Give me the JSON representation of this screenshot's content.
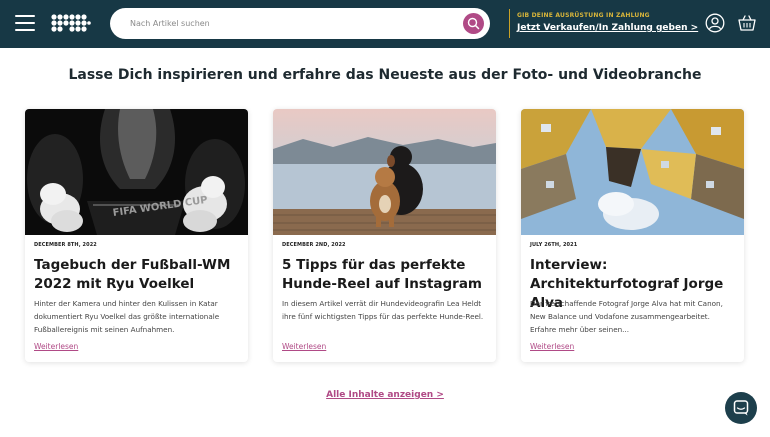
{
  "header": {
    "search_placeholder": "Nach Artikel suchen",
    "promo_top": "GIB DEINE AUSRÜSTUNG IN ZAHLUNG",
    "promo_link": "Jetzt Verkaufen/In Zahlung geben >",
    "brand_color": "#173845",
    "accent_gold": "#d7b43a",
    "accent_pink": "#b04a86"
  },
  "section": {
    "subtitle": "Lasse Dich inspirieren und erfahre das Neueste aus der Foto- und Videobranche"
  },
  "articles": [
    {
      "date": "DECEMBER 8TH, 2022",
      "title": "Tagebuch der Fußball-WM 2022 mit Ryu Voelkel",
      "excerpt": "Hinter der Kamera und hinter den Kulissen in Katar dokumentiert Ryu Voelkel das größte internationale Fußballereignis mit seinen Aufnahmen.",
      "more": "Weiterlesen",
      "image_text": "FIFA WORLD CUP"
    },
    {
      "date": "DECEMBER 2ND, 2022",
      "title": "5 Tipps für das perfekte Hunde-Reel auf Instagram",
      "excerpt": "In diesem Artikel verrät dir Hundevideografin Lea Heldt ihre fünf wichtigsten Tipps für das perfekte Hunde-Reel.",
      "more": "Weiterlesen"
    },
    {
      "date": "JULY 26TH, 2021",
      "title": "Interview: Architekturfotograf Jorge Alva",
      "excerpt": "Der freischaffende Fotograf Jorge Alva hat mit Canon, New Balance und Vodafone zusammengearbeitet. Erfahre mehr über seinen...",
      "more": "Weiterlesen"
    }
  ],
  "footer": {
    "all_link": "Alle Inhalte anzeigen >"
  },
  "icons": [
    "menu-icon",
    "logo",
    "search-icon",
    "user-icon",
    "cart-icon",
    "chat-icon"
  ]
}
